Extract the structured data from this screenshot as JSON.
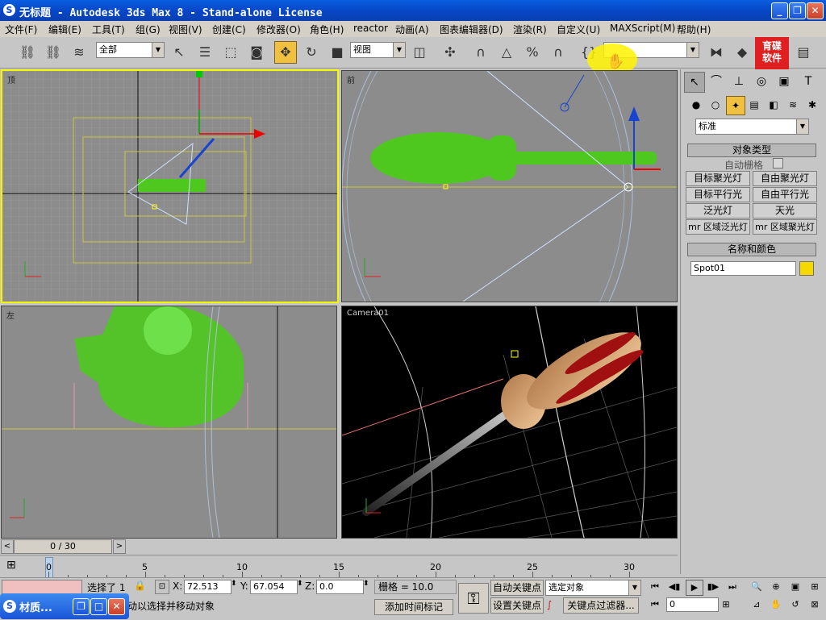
{
  "window": {
    "title": "无标题  - Autodesk 3ds Max 8  - Stand-alone License",
    "logo": "S"
  },
  "menu": [
    "文件(F)",
    "编辑(E)",
    "工具(T)",
    "组(G)",
    "视图(V)",
    "创建(C)",
    "修改器(O)",
    "角色(H)",
    "reactor",
    "动画(A)",
    "图表编辑器(D)",
    "渲染(R)",
    "自定义(U)",
    "MAXScript(M)",
    "帮助(H)"
  ],
  "toolbar": {
    "selection_filter": "全部",
    "ref_coord": "视图",
    "named_sel_placeholder": ""
  },
  "brand": {
    "line1": "育碟",
    "line2": "软件"
  },
  "viewports": {
    "top": "顶",
    "front": "前",
    "left": "左",
    "camera": "Camera01"
  },
  "command_panel": {
    "category": "标准",
    "object_type_title": "对象类型",
    "autogrid_label": "自动栅格",
    "buttons": [
      "目标聚光灯",
      "自由聚光灯",
      "目标平行光",
      "自由平行光",
      "泛光灯",
      "天光",
      "mr 区域泛光灯",
      "mr 区域聚光灯"
    ],
    "name_color_title": "名称和颜色",
    "object_name": "Spot01",
    "object_color": "#f5d800"
  },
  "timeline": {
    "frame_display": "0 / 30",
    "ticks": [
      "0",
      "5",
      "10",
      "15",
      "20",
      "25",
      "30"
    ]
  },
  "status": {
    "selected": "选择了 1",
    "x_label": "X:",
    "x_value": "72.513",
    "y_label": "Y:",
    "y_value": "67.054",
    "z_label": "Z:",
    "z_value": "0.0",
    "grid": "栅格 = 10.0",
    "prompt": "动以选择并移动对象",
    "add_time_tag": "添加时间标记",
    "auto_key": "自动关键点",
    "set_key": "设置关键点",
    "selected_object": "选定对象",
    "key_filters": "关键点过滤器...",
    "current_frame": "0"
  },
  "taskbar": {
    "app": "材质..."
  },
  "colors": {
    "selection": "#f5f500",
    "wire_green": "#4ec81e",
    "grid": "#a8a8a8"
  }
}
